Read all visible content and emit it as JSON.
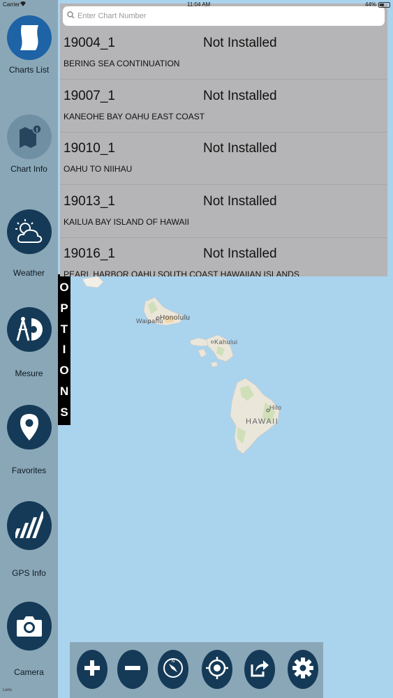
{
  "status_bar": {
    "carrier": "Carrier",
    "time": "11:04 AM",
    "battery": "44%"
  },
  "sidebar": {
    "items": [
      {
        "label": "Charts List",
        "icon": "scroll-icon"
      },
      {
        "label": "Chart Info",
        "icon": "map-info-icon"
      },
      {
        "label": "Weather",
        "icon": "sun-cloud-icon"
      },
      {
        "label": "Mesure",
        "icon": "compass-ruler-icon"
      },
      {
        "label": "Favorites",
        "icon": "location-pin-icon"
      },
      {
        "label": "GPS Info",
        "icon": "signal-bars-icon"
      },
      {
        "label": "Camera",
        "icon": "camera-icon"
      }
    ],
    "lens_label": "Lens"
  },
  "options_tab": {
    "letters": [
      "O",
      "P",
      "T",
      "I",
      "O",
      "N",
      "S"
    ]
  },
  "chart_panel": {
    "search_placeholder": "Enter Chart Number",
    "charts": [
      {
        "number": "19004_1",
        "status": "Not Installed",
        "name": "BERING SEA CONTINUATION"
      },
      {
        "number": "19007_1",
        "status": "Not Installed",
        "name": "KANEOHE BAY  OAHU EAST COAST"
      },
      {
        "number": "19010_1",
        "status": "Not Installed",
        "name": "OAHU TO NIIHAU"
      },
      {
        "number": "19013_1",
        "status": "Not Installed",
        "name": "KAILUA BAY ISLAND OF HAWAII"
      },
      {
        "number": "19016_1",
        "status": "Not Installed",
        "name": "PEARL HARBOR  OAHU SOUTH COAST  HAWAIIAN ISLANDS"
      }
    ]
  },
  "map": {
    "labels": {
      "waipahu": "Waipahu",
      "honolulu": "Honolulu",
      "kahului": "Kahului",
      "hilo": "Hilo",
      "hawaii": "HAWAII"
    }
  },
  "toolbar": {
    "buttons": [
      {
        "icon": "zoom-in-icon"
      },
      {
        "icon": "zoom-out-icon"
      },
      {
        "icon": "compass-icon"
      },
      {
        "icon": "locate-icon"
      },
      {
        "icon": "share-icon"
      },
      {
        "icon": "settings-icon"
      }
    ]
  },
  "colors": {
    "sidebar_bg": "#8aa7b8",
    "icon_circle": "#153a57",
    "active_circle": "#1d63a5",
    "panel_bg": "#b5b4b6",
    "ocean": "#aad3ee"
  }
}
